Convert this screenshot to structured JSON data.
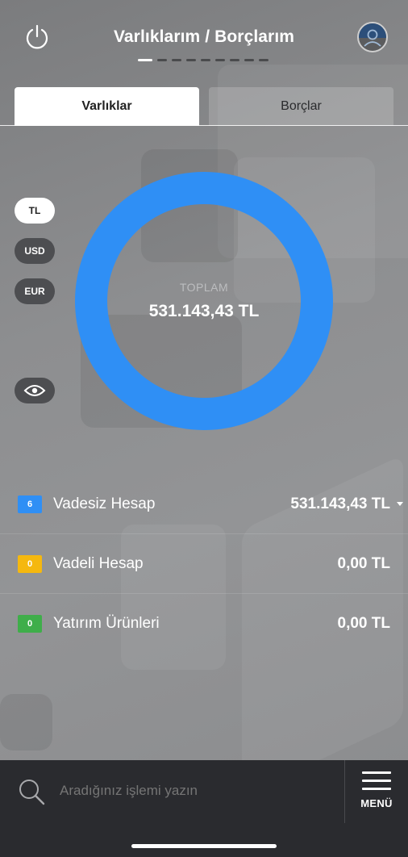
{
  "header": {
    "title": "Varlıklarım / Borçlarım",
    "pager_total": 9,
    "pager_active": 1
  },
  "tabs": {
    "assets": "Varlıklar",
    "debts": "Borçlar"
  },
  "currencies": [
    {
      "label": "TL",
      "active": true
    },
    {
      "label": "USD",
      "active": false
    },
    {
      "label": "EUR",
      "active": false
    }
  ],
  "donut": {
    "label": "TOPLAM",
    "value": "531.143,43 TL",
    "ring_color": "#2f8ff5"
  },
  "accounts": [
    {
      "count": "6",
      "label": "Vadesiz Hesap",
      "value": "531.143,43 TL",
      "color": "#2f8ff5"
    },
    {
      "count": "0",
      "label": "Vadeli Hesap",
      "value": "0,00 TL",
      "color": "#f5b80f"
    },
    {
      "count": "0",
      "label": "Yatırım Ürünleri",
      "value": "0,00 TL",
      "color": "#3fae4a"
    }
  ],
  "bottom": {
    "search_placeholder": "Aradığınız işlemi yazın",
    "menu_label": "MENÜ"
  }
}
